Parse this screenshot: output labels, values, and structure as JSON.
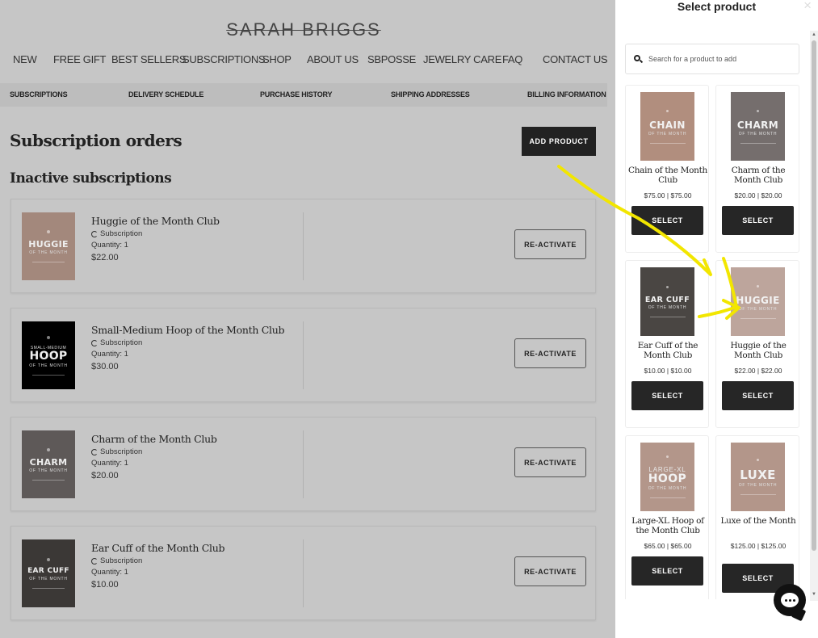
{
  "brand": {
    "logo": "SARAH BRIGGS"
  },
  "main_nav": [
    "NEW",
    "FREE GIFT",
    "BEST SELLERS",
    "SUBSCRIPTIONS",
    "SHOP",
    "ABOUT US",
    "SBPOSSE",
    "JEWELRY CARE",
    "FAQ",
    "CONTACT US"
  ],
  "sub_nav": [
    "SUBSCRIPTIONS",
    "DELIVERY SCHEDULE",
    "PURCHASE HISTORY",
    "SHIPPING ADDRESSES",
    "BILLING INFORMATION"
  ],
  "page": {
    "title": "Subscription orders",
    "section_title": "Inactive subscriptions",
    "add_product_label": "ADD PRODUCT"
  },
  "subscriptions": [
    {
      "name": "Huggie of the Month Club",
      "type": "Subscription",
      "quantity": "Quantity: 1",
      "price": "$22.00",
      "action": "RE-ACTIVATE",
      "thumb": {
        "main": "HUGGIE",
        "pre": "",
        "sub": "OF THE MONTH",
        "color": "#a3887c"
      }
    },
    {
      "name": "Small-Medium Hoop of the Month Club",
      "type": "Subscription",
      "quantity": "Quantity: 1",
      "price": "$30.00",
      "action": "RE-ACTIVATE",
      "thumb": {
        "main": "HOOP",
        "pre": "SMALL-MEDIUM",
        "sub": "OF THE MONTH",
        "color": "#000000"
      }
    },
    {
      "name": "Charm of the Month Club",
      "type": "Subscription",
      "quantity": "Quantity: 1",
      "price": "$20.00",
      "action": "RE-ACTIVATE",
      "thumb": {
        "main": "CHARM",
        "pre": "",
        "sub": "OF THE MONTH",
        "color": "#5e5958"
      }
    },
    {
      "name": "Ear Cuff of the Month Club",
      "type": "Subscription",
      "quantity": "Quantity: 1",
      "price": "$10.00",
      "action": "RE-ACTIVATE",
      "thumb": {
        "main": "EAR CUFF",
        "pre": "",
        "sub": "OF THE MONTH",
        "color": "#3b3836"
      }
    }
  ],
  "panel": {
    "title": "Select product",
    "close": "×",
    "search_placeholder": "Search for a product to add",
    "select_label": "SELECT",
    "products": [
      {
        "name": "Chain of the Month Club",
        "price": "$75.00 | $75.00",
        "thumb": {
          "main": "CHAIN",
          "pre": "",
          "sub": "OF THE MONTH",
          "color": "#b18e7e"
        }
      },
      {
        "name": "Charm of the Month Club",
        "price": "$20.00 | $20.00",
        "thumb": {
          "main": "CHARM",
          "pre": "",
          "sub": "OF THE MONTH",
          "color": "#756e6d"
        }
      },
      {
        "name": "Ear Cuff of the Month Club",
        "price": "$10.00 | $10.00",
        "thumb": {
          "main": "EAR CUFF",
          "pre": "",
          "sub": "OF THE MONTH",
          "color": "#4a4643"
        }
      },
      {
        "name": "Huggie of the Month Club",
        "price": "$22.00 | $22.00",
        "thumb": {
          "main": "HUGGIE",
          "pre": "",
          "sub": "OF THE MONTH",
          "color": "#bda59c"
        }
      },
      {
        "name": "Large-XL Hoop of the Month Club",
        "price": "$65.00 | $65.00",
        "thumb": {
          "main": "HOOP",
          "pre": "LARGE-XL",
          "sub": "OF THE MONTH",
          "color": "#b3968a"
        }
      },
      {
        "name": "Luxe of the Month",
        "price": "$125.00 | $125.00",
        "thumb": {
          "main": "LUXE",
          "pre": "",
          "sub": "OF THE MONTH",
          "color": "#b3968a"
        }
      }
    ]
  },
  "colors": {
    "overlay": "#c6c6c6",
    "button_dark": "#262626",
    "annotation_yellow": "#f5e600"
  }
}
